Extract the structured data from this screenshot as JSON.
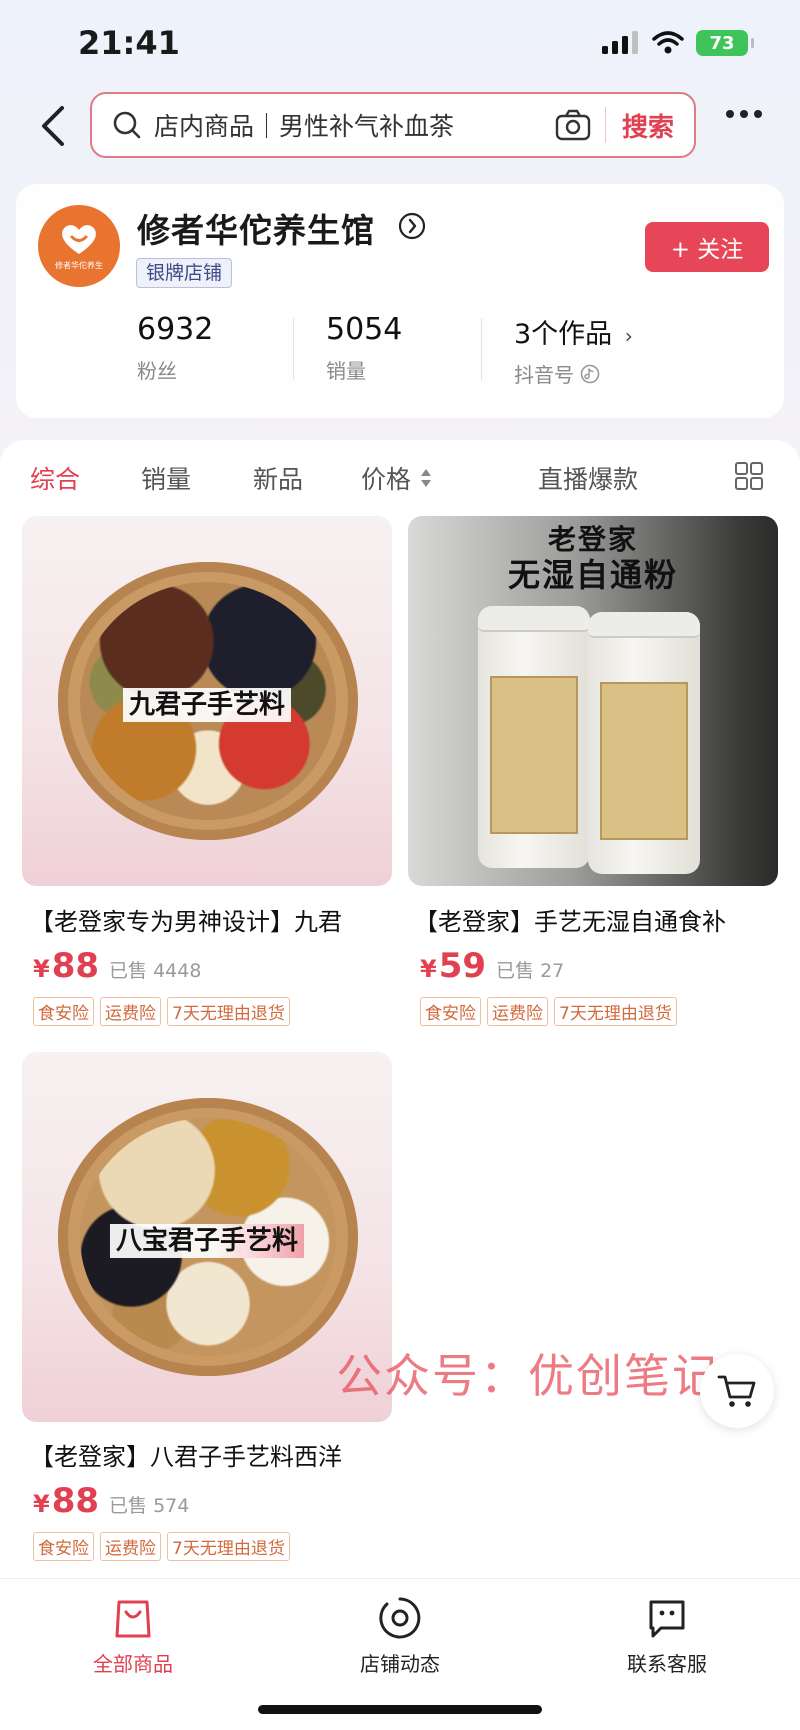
{
  "status_bar": {
    "time": "21:41",
    "battery": "73"
  },
  "search": {
    "placeholder": "店内商品｜男性补气补血茶",
    "button": "搜索"
  },
  "store": {
    "logo_text": "修者华佗养生",
    "name": "修者华佗养生馆",
    "badge": "银牌店铺",
    "follow_label": "+ 关注",
    "stats": [
      {
        "value": "6932",
        "label": "粉丝"
      },
      {
        "value": "5054",
        "label": "销量"
      },
      {
        "value": "3个作品",
        "label": "抖音号"
      }
    ]
  },
  "tabs": [
    {
      "label": "综合",
      "active": true
    },
    {
      "label": "销量"
    },
    {
      "label": "新品"
    },
    {
      "label": "价格"
    },
    {
      "label": "直播爆款"
    }
  ],
  "products": [
    {
      "image_text": "九君子手艺料",
      "title": "【老登家专为男神设计】九君",
      "currency": "¥",
      "price": "88",
      "sold": "已售 4448",
      "tags": [
        "食安险",
        "运费险",
        "7天无理由退货"
      ]
    },
    {
      "image_text_lines": [
        "老登家",
        "无湿自通粉"
      ],
      "title": "【老登家】手艺无湿自通食补",
      "currency": "¥",
      "price": "59",
      "sold": "已售 27",
      "tags": [
        "食安险",
        "运费险",
        "7天无理由退货"
      ]
    },
    {
      "image_text": "八宝君子手艺料",
      "title": "【老登家】八君子手艺料西洋",
      "currency": "¥",
      "price": "88",
      "sold": "已售 574",
      "tags": [
        "食安险",
        "运费险",
        "7天无理由退货"
      ]
    }
  ],
  "watermark": "公众号：优创笔记",
  "bottom_nav": [
    {
      "label": "全部商品",
      "icon": "bag-icon",
      "active": true
    },
    {
      "label": "店铺动态",
      "icon": "camera-lens-icon"
    },
    {
      "label": "联系客服",
      "icon": "chat-bubble-icon"
    }
  ],
  "colors": {
    "accent": "#e0404f",
    "follow_button": "#e64657",
    "tag_text": "#d16a3c"
  }
}
